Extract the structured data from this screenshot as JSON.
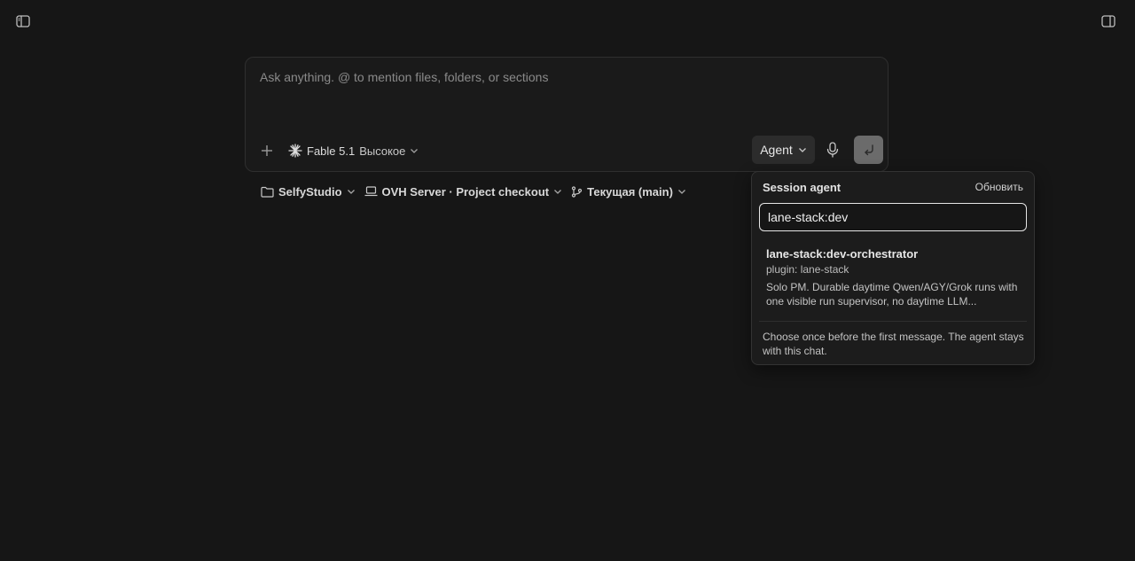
{
  "composer": {
    "placeholder": "Ask anything. @ to mention files, folders, or sections",
    "model": {
      "name": "Fable 5.1",
      "effort": "Высокое"
    },
    "agent_label": "Agent"
  },
  "context": {
    "workspace": "SelfyStudio",
    "environment": "OVH Server · Project checkout",
    "branch": "Текущая (main)"
  },
  "session_agent": {
    "title": "Session agent",
    "refresh_label": "Обновить",
    "search_value": "lane-stack:dev",
    "options": [
      {
        "name": "lane-stack:dev-orchestrator",
        "plugin": "plugin: lane-stack",
        "description": "Solo PM. Durable daytime Qwen/AGY/Grok runs with one visible run supervisor, no daytime LLM..."
      }
    ],
    "footer": "Choose once before the first message. The agent stays with this chat."
  },
  "icons": {
    "left_corner": "sidebar-left-icon",
    "right_corner": "sidebar-right-icon",
    "add": "plus-icon",
    "model": "sparkle-icon",
    "mic": "microphone-icon",
    "send": "return-arrow-icon",
    "folder": "folder-icon",
    "laptop": "laptop-icon",
    "branch": "git-branch-icon"
  }
}
